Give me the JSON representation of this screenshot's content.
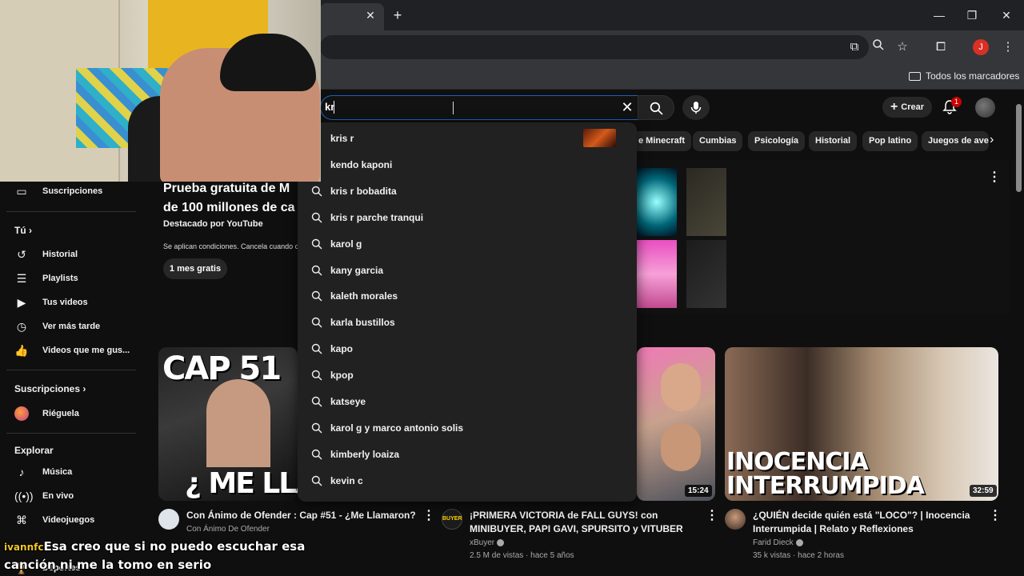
{
  "browser": {
    "bookmarks_all": "Todos los marcadores",
    "profile_initial": "J"
  },
  "search": {
    "query": "kr",
    "suggestions": [
      {
        "label": "kris r",
        "has_thumb": true
      },
      {
        "label": "kendo kaponi",
        "has_thumb": false
      },
      {
        "label": "kris r bobadita"
      },
      {
        "label": "kris r parche tranqui"
      },
      {
        "label": "karol g"
      },
      {
        "label": "kany garcia"
      },
      {
        "label": "kaleth morales"
      },
      {
        "label": "karla bustillos"
      },
      {
        "label": "kapo"
      },
      {
        "label": "kpop"
      },
      {
        "label": "katseye"
      },
      {
        "label": "karol g y marco antonio solis"
      },
      {
        "label": "kimberly loaiza"
      },
      {
        "label": "kevin c"
      }
    ]
  },
  "header": {
    "create_label": "Crear",
    "notifications_count": "1"
  },
  "chips": [
    "e Minecraft",
    "Cumbias",
    "Psicología",
    "Historial",
    "Pop latino",
    "Juegos de aven"
  ],
  "sidebar": {
    "subscriptions_item": "Suscripciones",
    "you_heading": "Tú",
    "you_items": [
      "Historial",
      "Playlists",
      "Tus videos",
      "Ver más tarde",
      "Videos que me gus..."
    ],
    "subs_heading": "Suscripciones",
    "subs_items": [
      "Riéguela"
    ],
    "explore_heading": "Explorar",
    "explore_items": [
      "Música",
      "En vivo",
      "Videojuegos",
      "Deportes"
    ]
  },
  "promo": {
    "title_line1": "Prueba gratuita de M",
    "title_line2": "de 100 millones de ca",
    "subtitle": "Destacado por YouTube",
    "conditions": "Se aplican condiciones. Cancela cuando c",
    "button": "1 mes gratis"
  },
  "videos": [
    {
      "thumb_text_top": "CAP 51",
      "thumb_text_bottom": "¿ ME LLA",
      "title": "Con Ánimo de Ofender : Cap #51 - ¿Me Llamaron?",
      "channel": "Con Ánimo De Ofender",
      "meta": "",
      "duration": ""
    },
    {
      "thumb_text_top": "",
      "thumb_text_bottom": "",
      "title": "¡PRIMERA VICTORIA de FALL GUYS! con MINIBUYER, PAPI GAVI, SPURSITO y VITUBER",
      "channel": "xBuyer",
      "meta": "2.5 M de vistas · hace 5 años",
      "duration": "15:24",
      "channel_badge": "BUYER"
    },
    {
      "thumb_text_top": "INOCENCIA",
      "thumb_text_bottom": "INTERRUMPIDA",
      "title": "¿QUIÉN decide quién está \"LOCO\"? | Inocencia Interrumpida | Relato y Reflexiones",
      "channel": "Farid Dieck",
      "meta": "35 k vistas · hace 2 horas",
      "duration": "32:59"
    }
  ],
  "chat": {
    "user": "ivannfc",
    "message": "Esa creo que si no puedo escuchar esa canción ni me la tomo en serio"
  },
  "colors": {
    "accent_blue": "#1c62b9",
    "badge_red": "#cc0000",
    "background": "#0f0f0f"
  }
}
